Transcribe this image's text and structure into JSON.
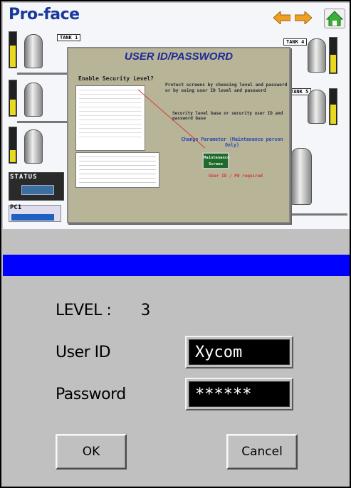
{
  "hmi": {
    "brand": "Pro-face",
    "tanks": [
      "TANK 1",
      "TANK 4",
      "TANK 5"
    ],
    "status_label": "STATUS",
    "pc_label": "PC1",
    "modal": {
      "title": "USER ID/PASSWORD",
      "subtitle": "Enable Security Level?",
      "description": "Protect screens by choosing level and password or by using user ID level and password",
      "note": "Security level base or security user ID and password base",
      "change_param": "Change Parameter (Maintenance person Only)",
      "maint_button": "Maintenance Screen",
      "footer_note": "User ID / PW required"
    }
  },
  "login": {
    "level_label": "LEVEL :",
    "level_value": "3",
    "user_id_label": "User ID",
    "user_id_value": "Xycom",
    "password_label": "Password",
    "password_value": "******",
    "ok_label": "OK",
    "cancel_label": "Cancel"
  },
  "colors": {
    "separator": "#0000ff",
    "panel": "#c0c0c0",
    "field_bg": "#000000",
    "modal_title": "#1c2a9a"
  }
}
